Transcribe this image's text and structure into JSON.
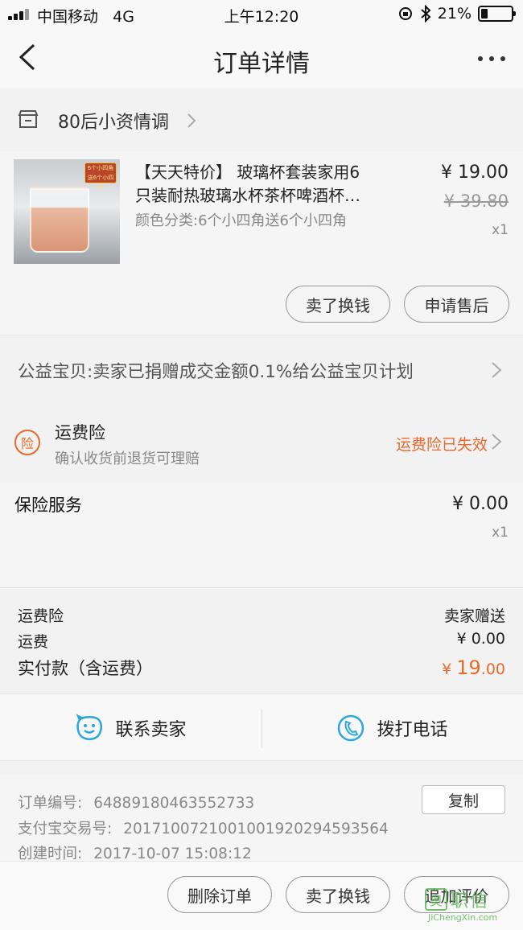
{
  "status_bar": {
    "carrier": "中国移动",
    "network": "4G",
    "time": "上午12:20",
    "battery": "21%",
    "battery_level": 0.21
  },
  "nav": {
    "title": "订单详情"
  },
  "shop": {
    "name": "80后小资情调"
  },
  "item": {
    "badge": "6个小四角 送6个小四角",
    "title_line1": "【天天特价】 玻璃杯套装家用6",
    "title_line2": "只装耐热玻璃水杯茶杯啤酒杯…",
    "sku": "颜色分类:6个小四角送6个小四角",
    "price": "¥ 19.00",
    "original_price": "¥ 39.80",
    "quantity": "x1",
    "sell_button": "卖了换钱",
    "after_sale_button": "申请售后"
  },
  "charity": {
    "text": "公益宝贝:卖家已捐赠成交金额0.1%给公益宝贝计划"
  },
  "insurance": {
    "icon_char": "险",
    "name": "运费险",
    "desc": "确认收货前退货可理赔",
    "status": "运费险已失效"
  },
  "service": {
    "name": "保险服务",
    "price": "¥ 0.00",
    "quantity": "x1"
  },
  "summary": {
    "insurance_label": "运费险",
    "insurance_value": "卖家赠送",
    "shipping_label": "运费",
    "shipping_value": "¥ 0.00",
    "paid_label": "实付款（含运费）",
    "paid_currency": "¥ ",
    "paid_int": "19",
    "paid_dec": ".00"
  },
  "contact": {
    "seller_label": "联系卖家",
    "phone_label": "拨打电话"
  },
  "order_info": {
    "order_no_label": "订单编号:",
    "order_no": "64889180463552733",
    "alipay_label": "支付宝交易号:",
    "alipay_no": "2017100721001001920294593564",
    "created_label": "创建时间:",
    "created": "2017-10-07 15:08:12",
    "copy_button": "复制"
  },
  "bottom": {
    "delete_button": "删除订单",
    "sell_button": "卖了换钱",
    "review_button": "追加评价"
  },
  "watermark": {
    "logo_char": "奥",
    "cn": "职信",
    "en": "JiChengXin.com"
  },
  "colors": {
    "accent": "#e8692c",
    "contact_icon": "#2aa7e0"
  }
}
